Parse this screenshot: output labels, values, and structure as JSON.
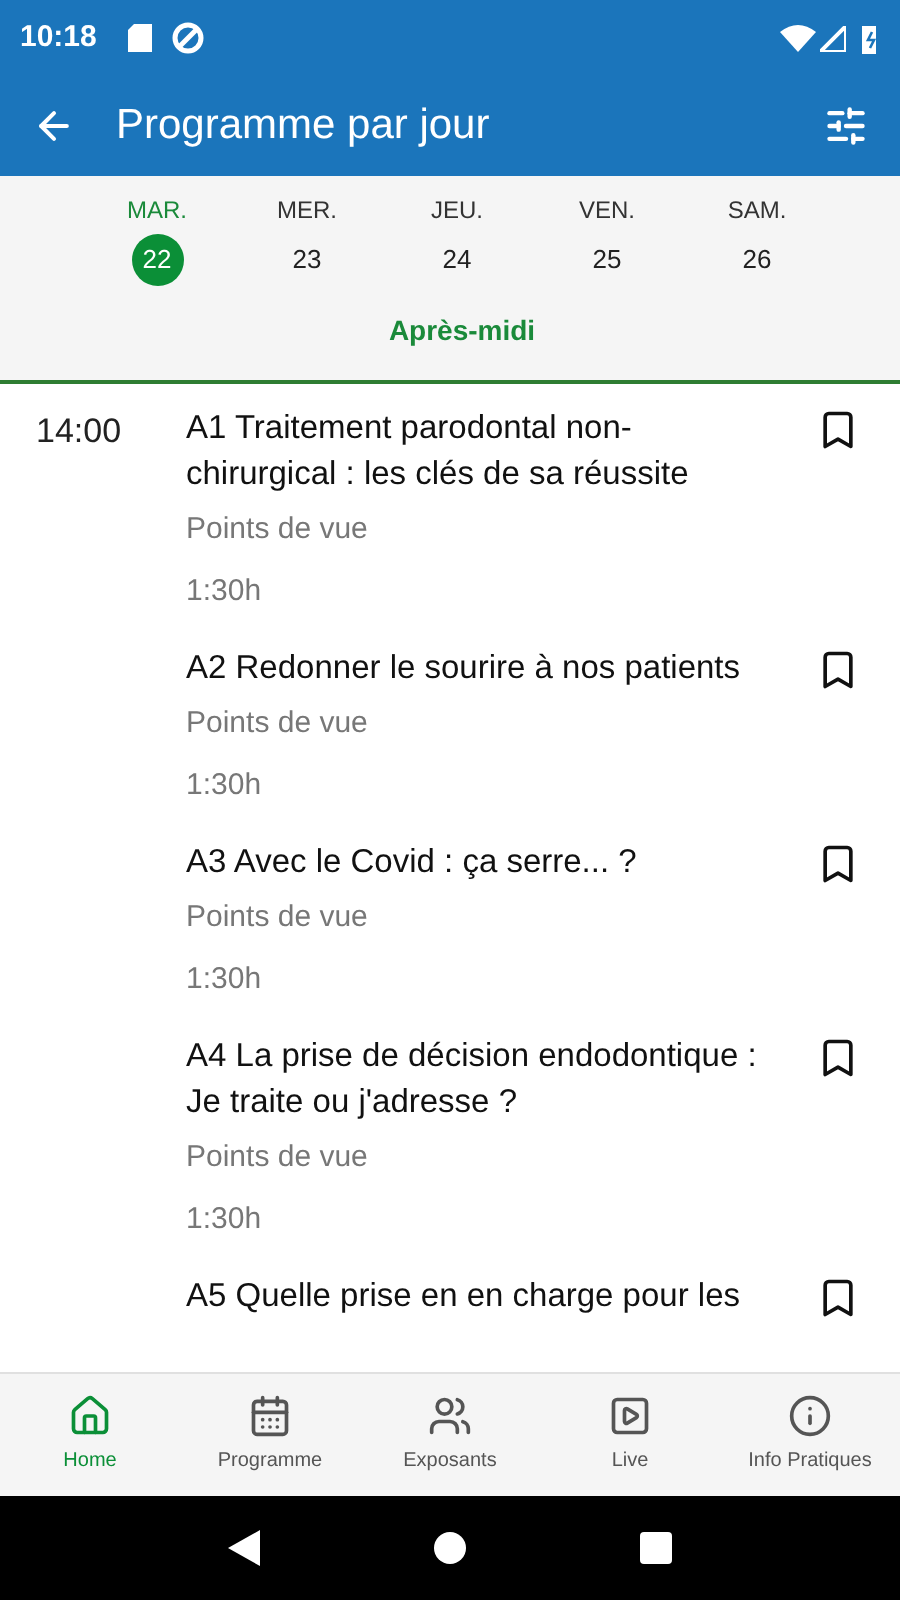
{
  "status_bar": {
    "time": "10:18"
  },
  "app_bar": {
    "title": "Programme par jour"
  },
  "days": [
    {
      "weekday": "MAR.",
      "date": "22",
      "selected": true
    },
    {
      "weekday": "MER.",
      "date": "23",
      "selected": false
    },
    {
      "weekday": "JEU.",
      "date": "24",
      "selected": false
    },
    {
      "weekday": "VEN.",
      "date": "25",
      "selected": false
    },
    {
      "weekday": "SAM.",
      "date": "26",
      "selected": false
    }
  ],
  "period": "Après-midi",
  "sessions": [
    {
      "time": "14:00",
      "title": "A1 Traitement parodontal non-chirurgical : les clés de sa réussite",
      "type": "Points de vue",
      "duration": "1:30h"
    },
    {
      "title": "A2 Redonner le sourire à nos patients",
      "type": "Points de vue",
      "duration": "1:30h"
    },
    {
      "title": "A3 Avec le Covid : ça serre... ?",
      "type": "Points de vue",
      "duration": "1:30h"
    },
    {
      "title": "A4 La prise de décision endodontique : Je traite ou j'adresse ?",
      "type": "Points de vue",
      "duration": "1:30h"
    },
    {
      "title": "A5 Quelle prise en en charge pour les"
    }
  ],
  "bottom_nav": [
    {
      "label": "Home",
      "selected": true
    },
    {
      "label": "Programme",
      "selected": false
    },
    {
      "label": "Exposants",
      "selected": false
    },
    {
      "label": "Live",
      "selected": false
    },
    {
      "label": "Info Pratiques",
      "selected": false
    }
  ]
}
